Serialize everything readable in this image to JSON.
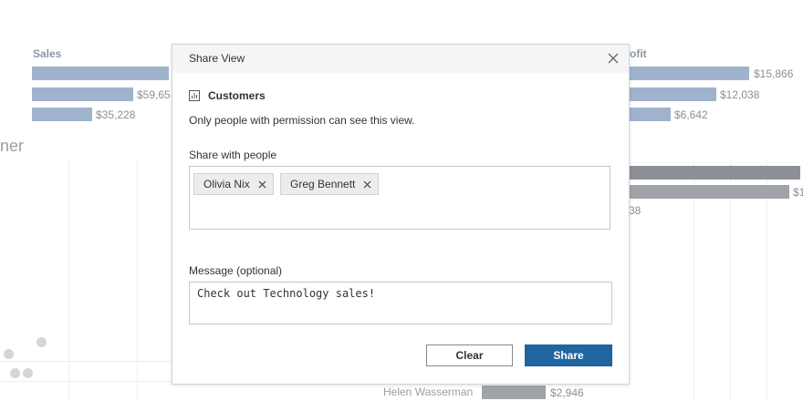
{
  "background": {
    "sales_label": "Sales",
    "profit_label": "ofit",
    "customer_heading": "ner",
    "sales_values": [
      "$59,65",
      "$35,228"
    ],
    "profit_values": [
      "$15,866",
      "$12,038",
      "$6,642"
    ],
    "right_values": [
      "$1",
      "38"
    ],
    "bottom_customer": "Helen Wasserman",
    "bottom_value": "$2,946",
    "colors": {
      "blue_bar": "#9fb3cc",
      "gray_bar": "#a0a4a8"
    }
  },
  "dialog": {
    "title": "Share View",
    "close_icon": "close-icon",
    "view_icon": "chart-icon",
    "view_name": "Customers",
    "permission_text": "Only people with permission can see this view.",
    "share_with_label": "Share with people",
    "recipients": [
      {
        "name": "Olivia Nix",
        "remove_icon": "close-icon"
      },
      {
        "name": "Greg Bennett",
        "remove_icon": "close-icon"
      }
    ],
    "message_label": "Message (optional)",
    "message_value": "Check out Technology sales!",
    "buttons": {
      "clear": "Clear",
      "share": "Share"
    },
    "colors": {
      "primary": "#1f66a0",
      "header_bg": "#f5f5f5"
    }
  }
}
